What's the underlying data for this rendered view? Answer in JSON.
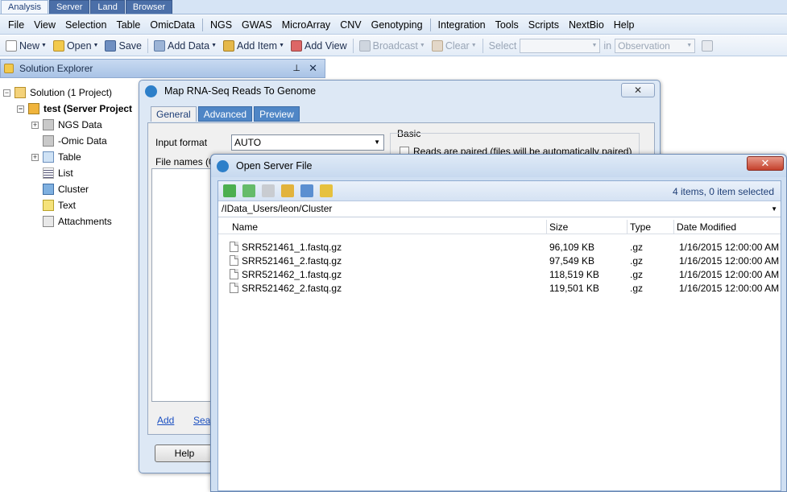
{
  "app_tabs": [
    "Analysis",
    "Server",
    "Land",
    "Browser"
  ],
  "menu": [
    "File",
    "View",
    "Selection",
    "Table",
    "OmicData",
    "NGS",
    "GWAS",
    "MicroArray",
    "CNV",
    "Genotyping",
    "Integration",
    "Tools",
    "Scripts",
    "NextBio",
    "Help"
  ],
  "toolbar": {
    "new_label": "New",
    "open_label": "Open",
    "save_label": "Save",
    "add_data_label": "Add Data",
    "add_item_label": "Add Item",
    "add_view_label": "Add View",
    "broadcast_label": "Broadcast",
    "clear_label": "Clear",
    "select_label": "Select",
    "in_label": "in",
    "observation_value": "Observation"
  },
  "solution_explorer": {
    "title": "Solution Explorer",
    "pin_icon": "pin-icon",
    "close_glyph": "✕",
    "root": "Solution (1 Project)",
    "project": "test (Server Project",
    "items": [
      "NGS Data",
      "-Omic Data",
      "Table",
      "List",
      "Cluster",
      "Text",
      "Attachments"
    ]
  },
  "map_dialog": {
    "title": "Map RNA-Seq Reads To Genome",
    "close_glyph": "✕",
    "tabs": [
      "General",
      "Advanced",
      "Preview"
    ],
    "input_format_label": "Input format",
    "input_format_value": "AUTO",
    "file_names_label": "File names (0)",
    "basic_label": "Basic",
    "reads_paired_label": "Reads are paired (files will be automatically paired)",
    "add_link": "Add",
    "search_link": "Sear",
    "help_button": "Help"
  },
  "open_server_file": {
    "title": "Open Server File",
    "close_glyph": "✕",
    "count_text": "4 items, 0 item selected",
    "path": "/IData_Users/leon/Cluster",
    "columns": [
      "Name",
      "Size",
      "Type",
      "Date Modified"
    ],
    "rows": [
      {
        "name": "SRR521461_1.fastq.gz",
        "size": "96,109 KB",
        "type": ".gz",
        "date": "1/16/2015 12:00:00 AM"
      },
      {
        "name": "SRR521461_2.fastq.gz",
        "size": "97,549 KB",
        "type": ".gz",
        "date": "1/16/2015 12:00:00 AM"
      },
      {
        "name": "SRR521462_1.fastq.gz",
        "size": "118,519 KB",
        "type": ".gz",
        "date": "1/16/2015 12:00:00 AM"
      },
      {
        "name": "SRR521462_2.fastq.gz",
        "size": "119,501 KB",
        "type": ".gz",
        "date": "1/16/2015 12:00:00 AM"
      }
    ]
  }
}
